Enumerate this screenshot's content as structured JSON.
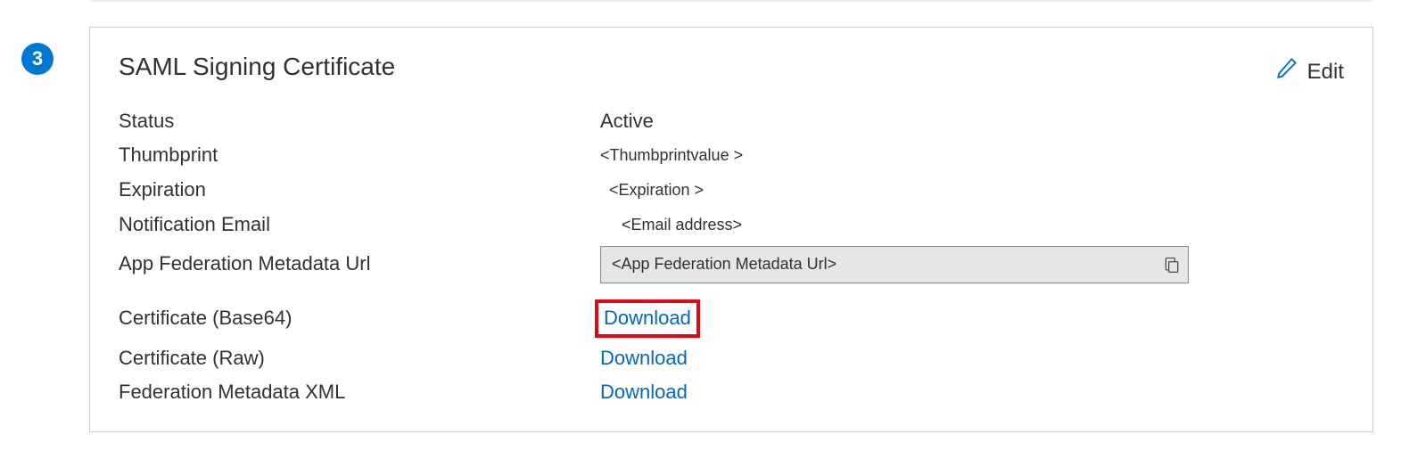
{
  "step": {
    "number": "3"
  },
  "card": {
    "title": "SAML Signing Certificate",
    "edit_label": "Edit"
  },
  "labels": {
    "status": "Status",
    "thumbprint": "Thumbprint",
    "expiration": "Expiration",
    "notification_email": "Notification Email",
    "app_federation_url": "App Federation Metadata Url",
    "cert_base64": "Certificate (Base64)",
    "cert_raw": "Certificate (Raw)",
    "federation_xml": "Federation Metadata XML"
  },
  "values": {
    "status": "Active",
    "thumbprint": "<Thumbprintvalue >",
    "expiration": "<Expiration >",
    "notification_email": "<Email address>",
    "app_federation_url": "<App Federation  Metadata Url>"
  },
  "actions": {
    "download_base64": "Download",
    "download_raw": "Download",
    "download_xml": "Download"
  },
  "colors": {
    "primary": "#0078d4",
    "link": "#0066cc",
    "highlight": "#e30613"
  }
}
